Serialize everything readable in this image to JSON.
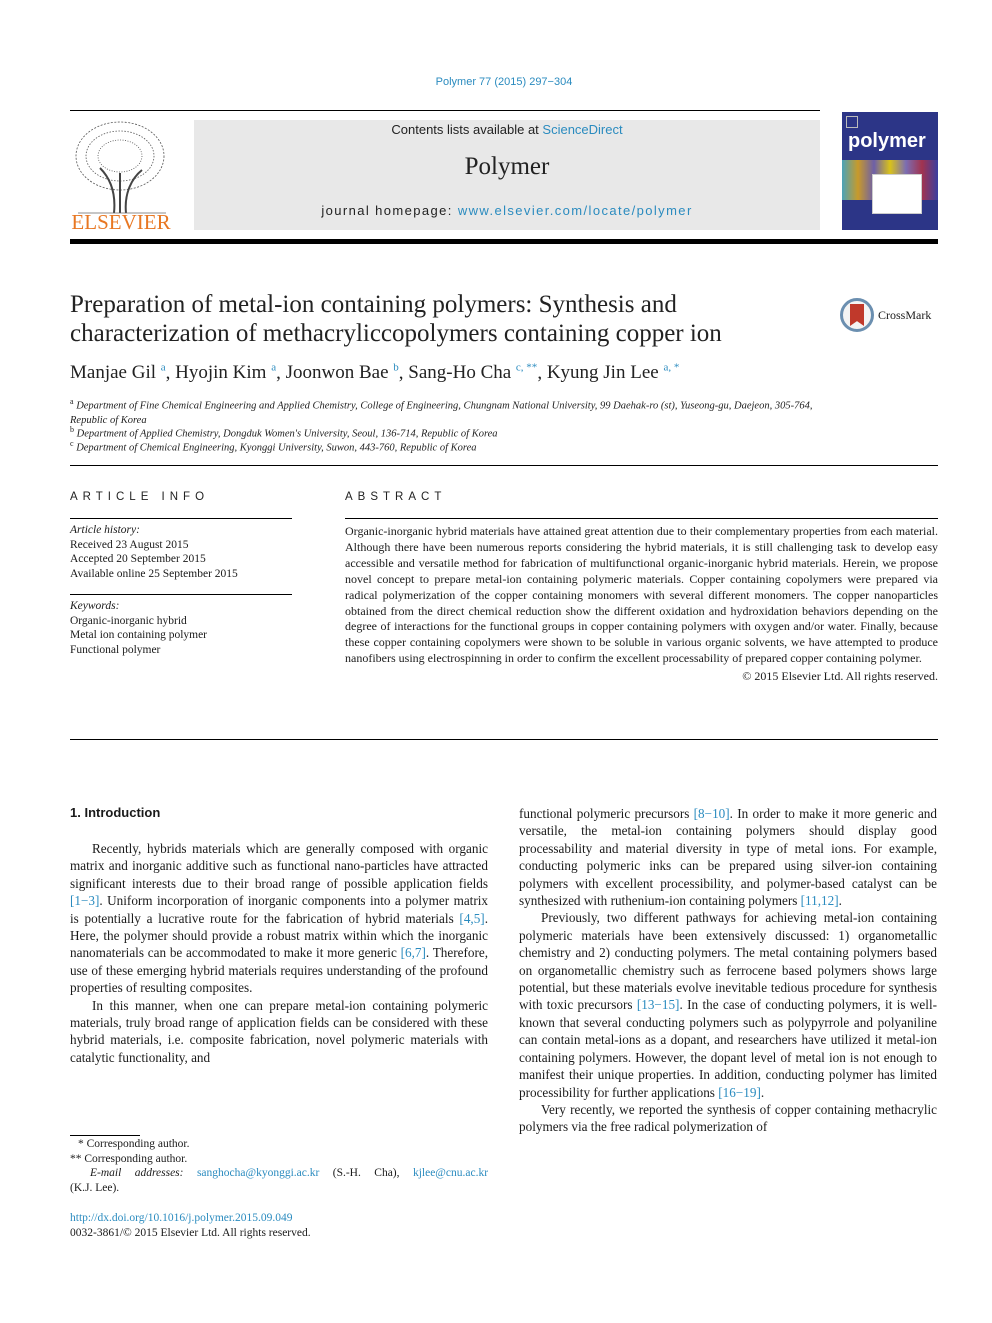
{
  "running_header": "Polymer 77 (2015) 297−304",
  "masthead": {
    "publisher_logo": "ELSEVIER",
    "contents_prefix": "Contents lists available at ",
    "contents_link": "ScienceDirect",
    "journal_name": "Polymer",
    "homepage_prefix": "journal homepage: ",
    "homepage_link": "www.elsevier.com/locate/polymer",
    "cover_title": "polymer"
  },
  "crossmark": "CrossMark",
  "title": "Preparation of metal-ion containing polymers: Synthesis and characterization of methacryliccopolymers containing copper ion",
  "authors": [
    {
      "name": "Manjae Gil",
      "sup": "a"
    },
    {
      "name": "Hyojin Kim",
      "sup": "a"
    },
    {
      "name": "Joonwon Bae",
      "sup": "b"
    },
    {
      "name": "Sang-Ho Cha",
      "sup": "c, **"
    },
    {
      "name": "Kyung Jin Lee",
      "sup": "a, *"
    }
  ],
  "affiliations": [
    {
      "sup": "a",
      "text": "Department of Fine Chemical Engineering and Applied Chemistry, College of Engineering, Chungnam National University, 99 Daehak-ro (st), Yuseong-gu, Daejeon, 305-764, Republic of Korea"
    },
    {
      "sup": "b",
      "text": "Department of Applied Chemistry, Dongduk Women's University, Seoul, 136-714, Republic of Korea"
    },
    {
      "sup": "c",
      "text": "Department of Chemical Engineering, Kyonggi University, Suwon, 443-760, Republic of Korea"
    }
  ],
  "article_info": {
    "heading": "ARTICLE INFO",
    "history_label": "Article history:",
    "history": [
      "Received 23 August 2015",
      "Accepted 20 September 2015",
      "Available online 25 September 2015"
    ],
    "keywords_label": "Keywords:",
    "keywords": [
      "Organic-inorganic hybrid",
      "Metal ion containing polymer",
      "Functional polymer"
    ]
  },
  "abstract": {
    "heading": "ABSTRACT",
    "text": "Organic-inorganic hybrid materials have attained great attention due to their complementary properties from each material. Although there have been numerous reports considering the hybrid materials, it is still challenging task to develop easy accessible and versatile method for fabrication of multifunctional organic-inorganic hybrid materials. Herein, we propose novel concept to prepare metal-ion containing polymeric materials. Copper containing copolymers were prepared via radical polymerization of the copper containing monomers with several different monomers. The copper nanoparticles obtained from the direct chemical reduction show the different oxidation and hydroxidation behaviors depending on the degree of interactions for the functional groups in copper containing polymers with oxygen and/or water. Finally, because these copper containing copolymers were shown to be soluble in various organic solvents, we have attempted to produce nanofibers using electrospinning in order to confirm the excellent processability of prepared copper containing polymer.",
    "copyright": "© 2015 Elsevier Ltd. All rights reserved."
  },
  "introduction": {
    "heading": "1.  Introduction",
    "left_paragraphs": [
      [
        {
          "t": "Recently, hybrids materials which are generally composed with organic matrix and inorganic additive such as functional nano-particles have attracted significant interests due to their broad range of possible application fields "
        },
        {
          "ref": "[1−3]"
        },
        {
          "t": ". Uniform incorporation of inorganic components into a polymer matrix is potentially a lucrative route for the fabrication of hybrid materials "
        },
        {
          "ref": "[4,5]"
        },
        {
          "t": ". Here, the polymer should provide a robust matrix within which the inorganic nanomaterials can be accommodated to make it more generic "
        },
        {
          "ref": "[6,7]"
        },
        {
          "t": ". Therefore, use of these emerging hybrid materials requires understanding of the profound properties of resulting composites."
        }
      ],
      [
        {
          "t": "In this manner, when one can prepare metal-ion containing polymeric materials, truly broad range of application fields can be considered with these hybrid materials, i.e. composite fabrication, novel polymeric materials with catalytic functionality, and"
        }
      ]
    ],
    "right_paragraphs": [
      [
        {
          "t": "functional polymeric precursors "
        },
        {
          "ref": "[8−10]"
        },
        {
          "t": ". In order to make it more generic and versatile, the metal-ion containing polymers should display good processability and material diversity in type of metal ions. For example, conducting polymeric inks can be prepared using silver-ion containing polymers with excellent processibility, and polymer-based catalyst can be synthesized with ruthenium-ion containing polymers "
        },
        {
          "ref": "[11,12]"
        },
        {
          "t": "."
        }
      ],
      [
        {
          "t": "Previously, two different pathways for achieving metal-ion containing polymeric materials have been extensively discussed: 1) organometallic chemistry and 2) conducting polymers. The metal containing polymers based on organometallic chemistry such as ferrocene based polymers shows large potential, but these materials evolve inevitable tedious procedure for synthesis with toxic precursors "
        },
        {
          "ref": "[13−15]"
        },
        {
          "t": ". In the case of conducting polymers, it is well-known that several conducting polymers such as polypyrrole and polyaniline can contain metal-ions as a dopant, and researchers have utilized it metal-ion containing polymers. However, the dopant level of metal ion is not enough to manifest their unique properties. In addition, conducting polymer has limited processibility for further applications "
        },
        {
          "ref": "[16−19]"
        },
        {
          "t": "."
        }
      ],
      [
        {
          "t": "Very recently, we reported the synthesis of copper containing methacrylic polymers via the free radical polymerization of"
        }
      ]
    ]
  },
  "footnotes": {
    "corr1": "*  Corresponding author.",
    "corr2": "**  Corresponding author.",
    "email_label": "E-mail addresses:",
    "email1": "sanghocha@kyonggi.ac.kr",
    "email1_name": "(S.-H. Cha),",
    "email2": "kjlee@cnu.ac.kr",
    "email2_name": "(K.J. Lee).",
    "doi": "http://dx.doi.org/10.1016/j.polymer.2015.09.049",
    "issn": "0032-3861/© 2015 Elsevier Ltd. All rights reserved."
  }
}
